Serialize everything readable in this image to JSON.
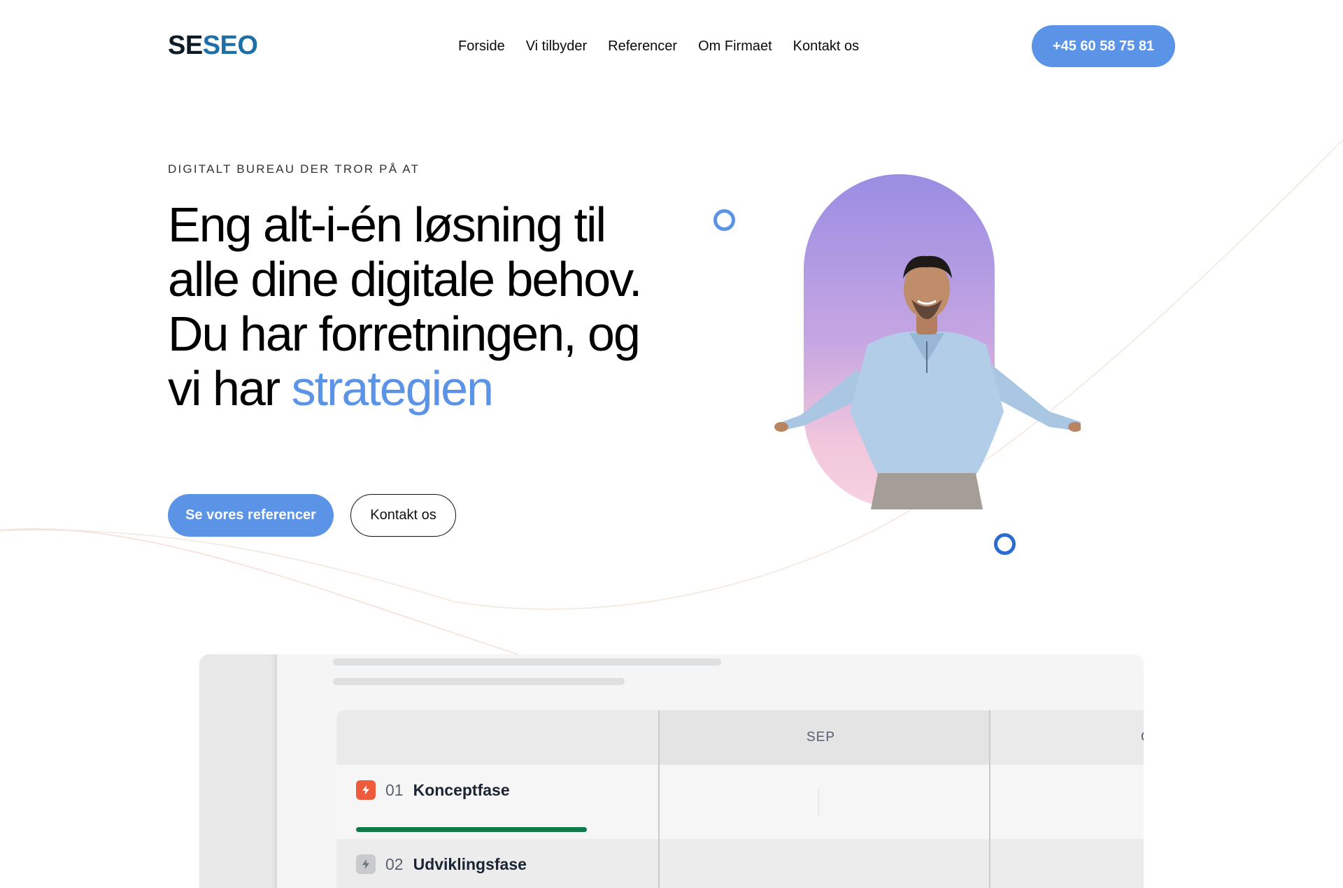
{
  "header": {
    "logo_part1": "SE",
    "logo_part2": "SEO",
    "nav": [
      {
        "label": "Forside"
      },
      {
        "label": "Vi tilbyder"
      },
      {
        "label": "Referencer"
      },
      {
        "label": "Om Firmaet"
      },
      {
        "label": "Kontakt os"
      }
    ],
    "phone_label": "+45 60 58 75 81"
  },
  "hero": {
    "eyebrow": "DIGITALT BUREAU DER TROR PÅ AT",
    "headline_main": "Eng alt-i-én løsning til alle dine digitale behov. Du har forretningen, og vi har",
    "headline_highlight": "strategien",
    "primary_button": "Se vores referencer",
    "secondary_button": "Kontakt os"
  },
  "dashboard": {
    "month": "SEP",
    "next_month_partial": "O",
    "phases": [
      {
        "number": "01",
        "name": "Konceptfase",
        "progress": 1.0
      },
      {
        "number": "02",
        "name": "Udviklingsfase"
      }
    ]
  },
  "colors": {
    "accent": "#5b93e6",
    "logo_dark": "#0d1b26",
    "logo_blue": "#1d6fa5",
    "phase_active": "#ee5a3c",
    "progress": "#0f7a48"
  }
}
